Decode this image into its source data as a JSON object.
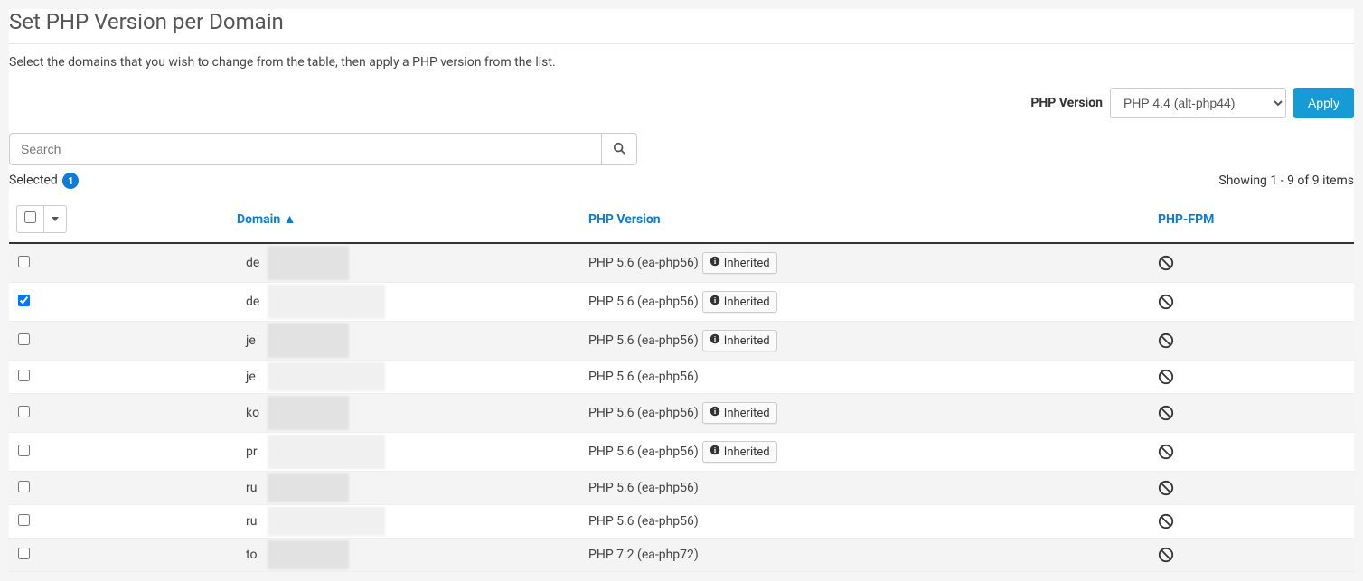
{
  "title": "Set PHP Version per Domain",
  "description": "Select the domains that you wish to change from the table, then apply a PHP version from the list.",
  "version_control": {
    "label": "PHP Version",
    "selected": "PHP 4.4 (alt-php44)",
    "apply_label": "Apply"
  },
  "search": {
    "placeholder": "Search"
  },
  "selection": {
    "label": "Selected",
    "count": "1"
  },
  "pagination": {
    "prefix": "Showing ",
    "range": "1 - 9 of 9 items"
  },
  "columns": {
    "domain": "Domain ▲",
    "php": "PHP Version",
    "fpm": "PHP-FPM"
  },
  "inherited_label": "Inherited",
  "rows": [
    {
      "checked": false,
      "domain": "de",
      "php": "PHP 5.6 (ea-php56)",
      "inherited": true
    },
    {
      "checked": true,
      "domain": "de",
      "php": "PHP 5.6 (ea-php56)",
      "inherited": true
    },
    {
      "checked": false,
      "domain": "je",
      "php": "PHP 5.6 (ea-php56)",
      "inherited": true
    },
    {
      "checked": false,
      "domain": "je",
      "php": "PHP 5.6 (ea-php56)",
      "inherited": false
    },
    {
      "checked": false,
      "domain": "ko",
      "php": "PHP 5.6 (ea-php56)",
      "inherited": true
    },
    {
      "checked": false,
      "domain": "pr",
      "php": "PHP 5.6 (ea-php56)",
      "inherited": true
    },
    {
      "checked": false,
      "domain": "ru",
      "php": "PHP 5.6 (ea-php56)",
      "inherited": false
    },
    {
      "checked": false,
      "domain": "ru",
      "php": "PHP 5.6 (ea-php56)",
      "inherited": false
    },
    {
      "checked": false,
      "domain": "to",
      "php": "PHP 7.2 (ea-php72)",
      "inherited": false
    }
  ]
}
